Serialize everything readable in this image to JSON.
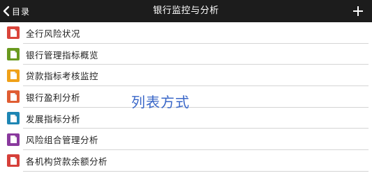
{
  "nav": {
    "back_label": "目录",
    "title": "银行监控与分析",
    "add_icon": "plus-icon",
    "back_icon": "chevron-left-icon"
  },
  "items": [
    {
      "label": "全行风险状况",
      "color": "#d9443a",
      "icon": "document-icon"
    },
    {
      "label": "银行管理指标概览",
      "color": "#6a9a1f",
      "icon": "document-icon"
    },
    {
      "label": "贷款指标考核监控",
      "color": "#f0a119",
      "icon": "document-icon"
    },
    {
      "label": "银行盈利分析",
      "color": "#e05d33",
      "icon": "document-icon"
    },
    {
      "label": "发展指标分析",
      "color": "#1e86b4",
      "icon": "document-icon"
    },
    {
      "label": "风险组合管理分析",
      "color": "#8a3a9e",
      "icon": "document-icon"
    },
    {
      "label": "各机构贷款余额分析",
      "color": "#d6403a",
      "icon": "document-icon"
    }
  ],
  "overlay_text": "列表方式"
}
